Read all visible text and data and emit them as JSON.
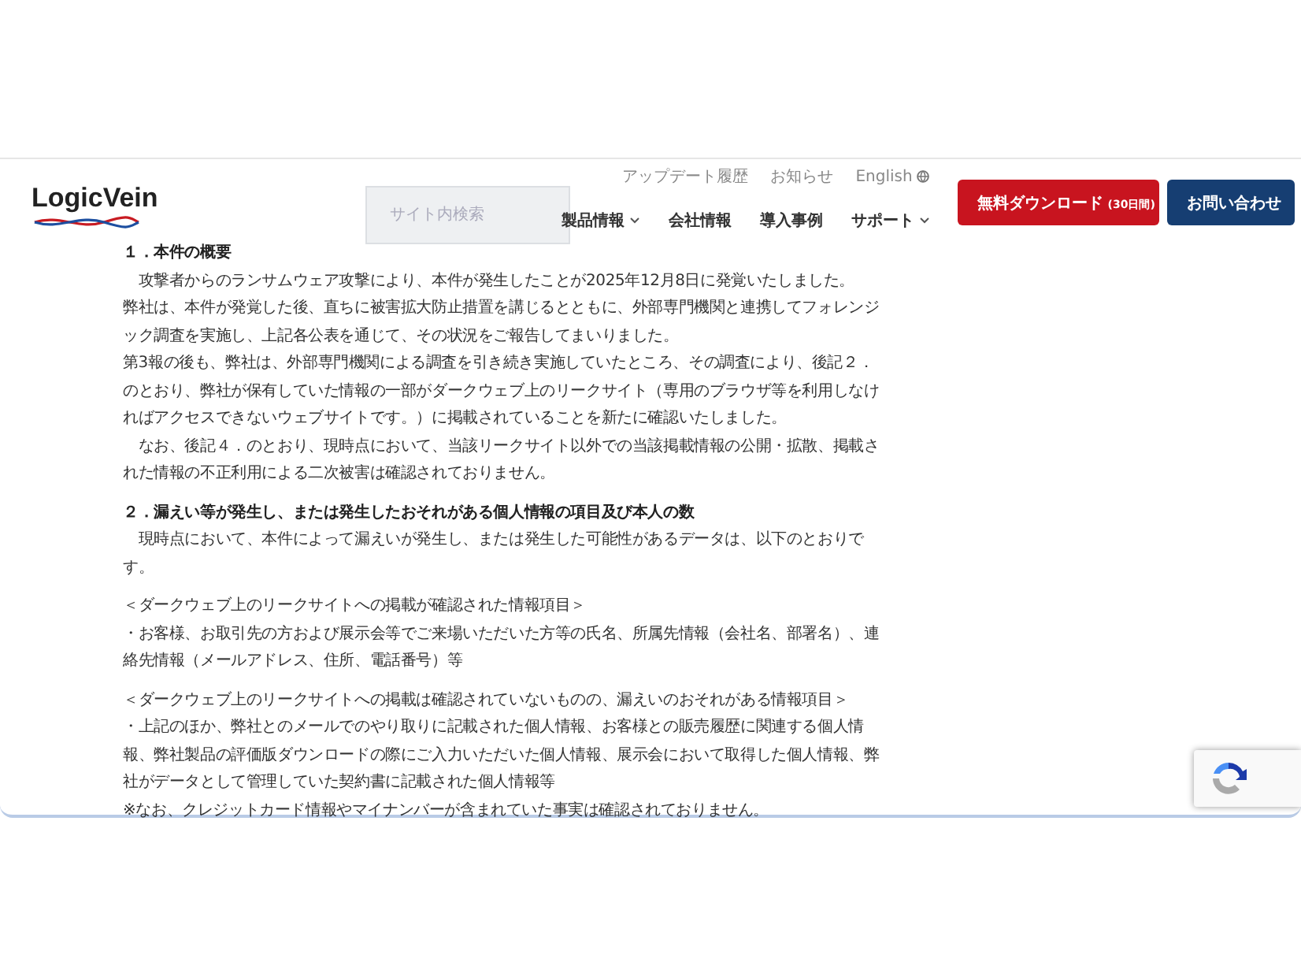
{
  "header": {
    "logo_text": "LogicVein",
    "search": {
      "placeholder": "サイト内検索"
    },
    "utility_links": [
      {
        "label": "アップデート履歴",
        "globe": false
      },
      {
        "label": "お知らせ",
        "globe": false
      },
      {
        "label": "English",
        "globe": true
      }
    ],
    "nav": [
      {
        "label": "製品情報",
        "dropdown": true
      },
      {
        "label": "会社情報",
        "dropdown": false
      },
      {
        "label": "導入事例",
        "dropdown": false
      },
      {
        "label": "サポート",
        "dropdown": true
      }
    ],
    "buttons": [
      {
        "label": "無料ダウンロード",
        "note": "(30日間)",
        "kind": "download"
      },
      {
        "label": "お問い合わせ",
        "kind": "contact"
      }
    ]
  },
  "article": {
    "sections": [
      {
        "heading": "１．本件の概要",
        "paragraphs": [
          "　攻撃者からのランサムウェア攻撃により、本件が発生したことが2025年12月8日に発覚いたしました。",
          "弊社は、本件が発覚した後、直ちに被害拡大防止措置を講じるとともに、外部専門機関と連携してフォレンジック調査を実施し、上記各公表を通じて、その状況をご報告してまいりました。",
          "第3報の後も、弊社は、外部専門機関による調査を引き続き実施していたところ、その調査により、後記２．のとおり、弊社が保有していた情報の一部がダークウェブ上のリークサイト（専用のブラウザ等を利用しなければアクセスできないウェブサイトです。）に掲載されていることを新たに確認いたしました。",
          "　なお、後記４．のとおり、現時点において、当該リークサイト以外での当該掲載情報の公開・拡散、掲載された情報の不正利用による二次被害は確認されておりません。"
        ]
      },
      {
        "heading": "２．漏えい等が発生し、または発生したおそれがある個人情報の項目及び本人の数",
        "paragraphs": [
          "　現時点において、本件によって漏えいが発生し、または発生した可能性があるデータは、以下のとおりです。"
        ]
      },
      {
        "paragraphs": [
          "＜ダークウェブ上のリークサイトへの掲載が確認された情報項目＞",
          "・お客様、お取引先の方および展示会等でご来場いただいた方等の氏名、所属先情報（会社名、部署名）、連絡先情報（メールアドレス、住所、電話番号）等"
        ]
      },
      {
        "paragraphs": [
          "＜ダークウェブ上のリークサイトへの掲載は確認されていないものの、漏えいのおそれがある情報項目＞",
          "・上記のほか、弊社とのメールでのやり取りに記載された個人情報、お客様との販売履歴に関連する個人情報、弊社製品の評価版ダウンロードの際にご入力いただいた個人情報、展示会において取得した個人情報、弊社がデータとして管理していた契約書に記載された個人情報等",
          "※なお、クレジットカード情報やマイナンバーが含まれていた事実は確認されておりません。"
        ]
      }
    ]
  }
}
